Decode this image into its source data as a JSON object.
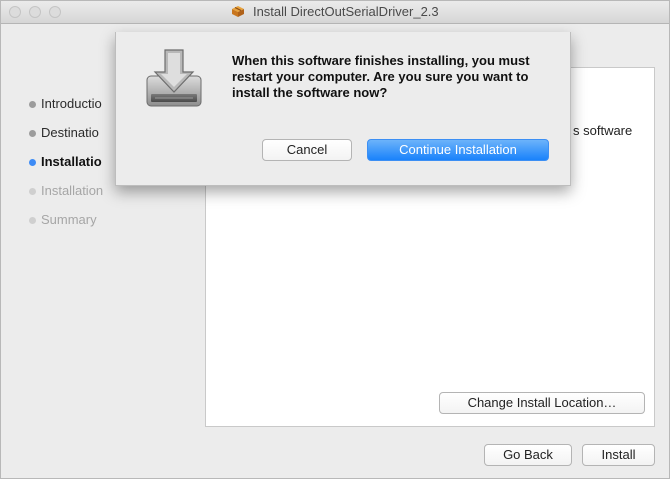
{
  "window": {
    "title": "Install DirectOutSerialDriver_2.3"
  },
  "sidebar": {
    "steps": [
      {
        "label": "Introductio",
        "state": "done"
      },
      {
        "label": "Destinatio",
        "state": "done"
      },
      {
        "label": "Installatio",
        "state": "active"
      },
      {
        "label": "Installation",
        "state": "pending"
      },
      {
        "label": "Summary",
        "state": "pending"
      }
    ]
  },
  "panel": {
    "partial_text": "s software"
  },
  "buttons": {
    "change_location": "Change Install Location…",
    "go_back": "Go Back",
    "install": "Install"
  },
  "dialog": {
    "message": "When this software finishes installing, you must restart your computer. Are you sure you want to install the software now?",
    "cancel_label": "Cancel",
    "continue_label": "Continue Installation",
    "icon": "drive-install-icon"
  },
  "colors": {
    "accent": "#1a82fb",
    "active_step_dot": "#3d8bf5"
  }
}
